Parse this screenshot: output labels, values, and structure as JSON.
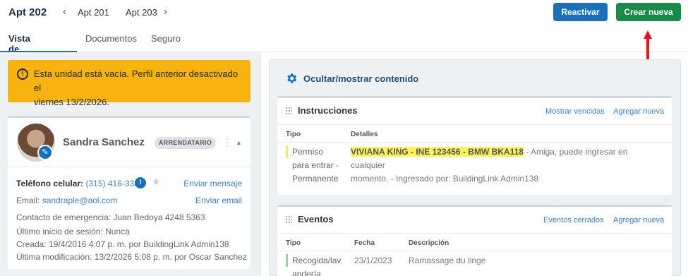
{
  "header": {
    "unit_title": "Apt 202",
    "prev_unit": "Apt 201",
    "next_unit": "Apt 203",
    "reactivate_label": "Reactivar",
    "create_label": "Crear nueva",
    "colors": {
      "reactivate": "#1b6fb8",
      "create": "#1a8a4b",
      "pointer_arrow": "#e3141b"
    }
  },
  "tabs": [
    {
      "label": "Vista de unidad",
      "active": true
    },
    {
      "label": "Documentos",
      "active": false
    },
    {
      "label": "Seguro",
      "active": false
    }
  ],
  "warning": {
    "line1": "Esta unidad está vacía. Perfil anterior desactivado el",
    "line2": "viernes 13/2/2026.",
    "color": "#f9b311"
  },
  "profile": {
    "name": "Sandra Sanchez",
    "role": "ARRENDATARIO",
    "phone_label": "Teléfono celular:",
    "phone": "(315) 416-3338",
    "send_message": "Enviar mensaje",
    "email_label": "Email:",
    "email": "sandraple@aol.com",
    "send_email": "Enviar email",
    "emergency_label": "Contacto de emergencia:",
    "emergency": "Juan Bedoya 4248 5363",
    "last_login_label": "Último inicio de sesión:",
    "last_login": "Nunca",
    "created_label": "Creada:",
    "created": "19/4/2016 4:07 p. m. por BuildingLink Admin138",
    "modified_label": "Última modificación:",
    "modified": "13/2/2026 5:08 p. m. por Oscar Sanchez"
  },
  "content": {
    "toggle_label": "Ocultar/mostrar contenido",
    "instructions": {
      "title": "Instrucciones",
      "show_expired": "Mostrar vencidas",
      "add_new": "Agregar nueva",
      "col_type": "Tipo",
      "col_details": "Detalles",
      "row": {
        "type_line1": "Permiso",
        "type_line2": "para entrar -",
        "type_line3": "Permanente",
        "highlight": "VIVIANA KING - INE 123456 - BMW BKA118",
        "detail_rest": " - Amiga, puede ingresar en cualquier",
        "detail_line2": "momento.  - Ingresado por: BuildingLink Admin138"
      }
    },
    "events": {
      "title": "Eventos",
      "closed_events": "Eventos cerrados",
      "add_new": "Agregar nueva",
      "col_type": "Tipo",
      "col_date": "Fecha",
      "col_desc": "Descripción",
      "row": {
        "type_line1": "Recogida/lav",
        "type_line2": "andería",
        "date": "23/1/2023",
        "desc": "Ramassage du linge"
      }
    }
  }
}
